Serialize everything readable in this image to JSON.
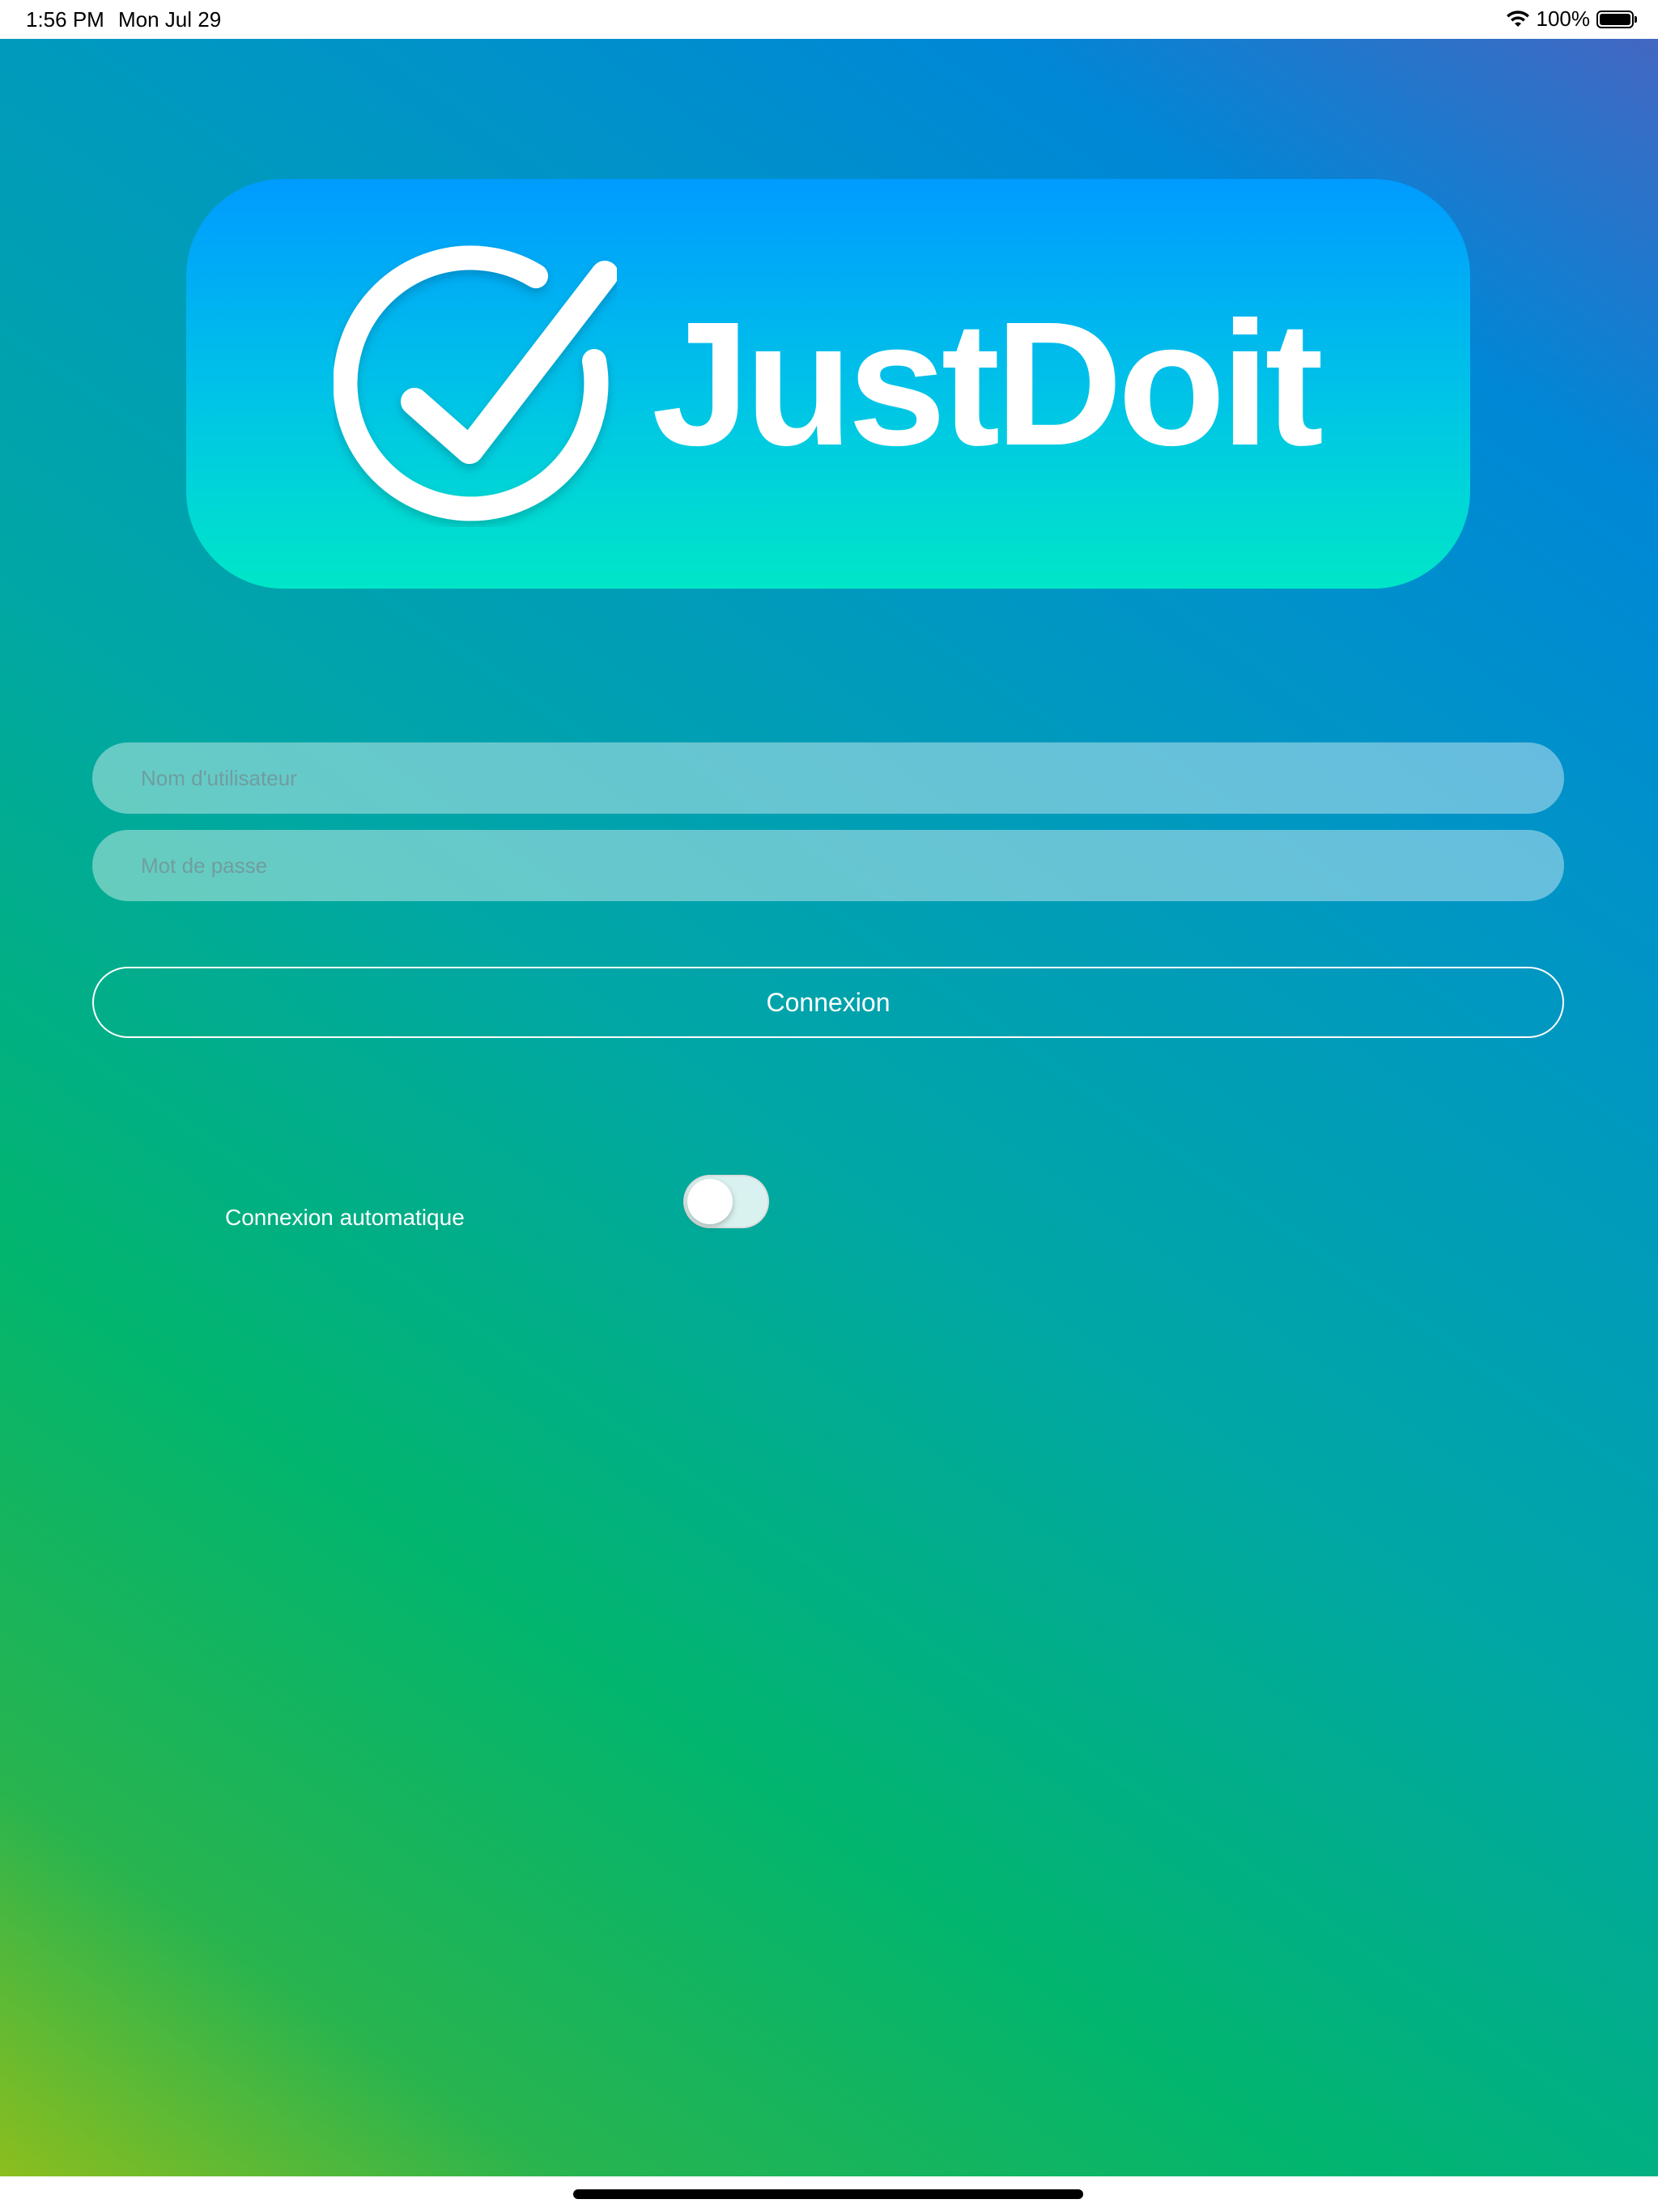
{
  "status_bar": {
    "time": "1:56 PM",
    "date": "Mon Jul 29",
    "battery": "100%",
    "icons": [
      "wifi-icon",
      "battery-icon"
    ]
  },
  "logo": {
    "text": "JustDoit",
    "icon": "check-circle-icon"
  },
  "login": {
    "username_placeholder": "Nom d'utilisateur",
    "password_placeholder": "Mot de passe",
    "submit_label": "Connexion",
    "auto_login_label": "Connexion automatique",
    "auto_login_enabled": false
  },
  "colors": {
    "background_top_right": "#4367c2",
    "background_mid": "#00a7a4",
    "background_bottom_left": "#8cbe1e",
    "logo_top": "#009bff",
    "logo_bottom": "#00e6c8"
  }
}
